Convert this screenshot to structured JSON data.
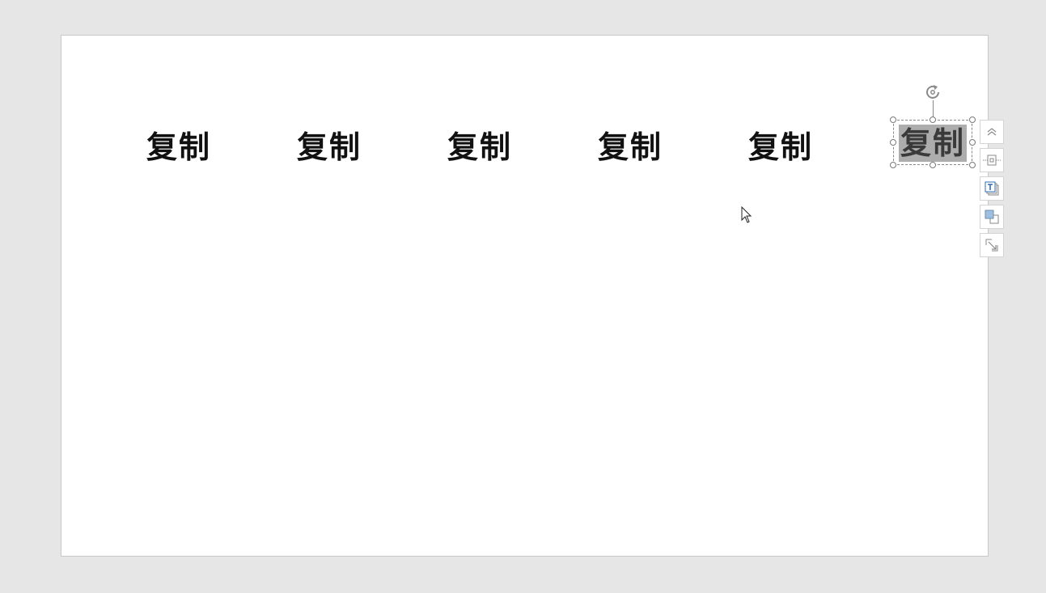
{
  "slide": {
    "text_boxes": [
      {
        "text": "复制",
        "selected": false
      },
      {
        "text": "复制",
        "selected": false
      },
      {
        "text": "复制",
        "selected": false
      },
      {
        "text": "复制",
        "selected": false
      },
      {
        "text": "复制",
        "selected": false
      },
      {
        "text": "复制",
        "selected": true
      }
    ]
  },
  "side_toolbar": {
    "buttons": [
      "collapse-icon",
      "layout-options-icon",
      "text-wrap-icon",
      "arrange-shape-icon",
      "resize-shape-icon"
    ]
  },
  "colors": {
    "canvas_background": "#e6e6e6",
    "slide_background": "#ffffff",
    "text": "#111111",
    "selection_highlight": "#adadad"
  }
}
